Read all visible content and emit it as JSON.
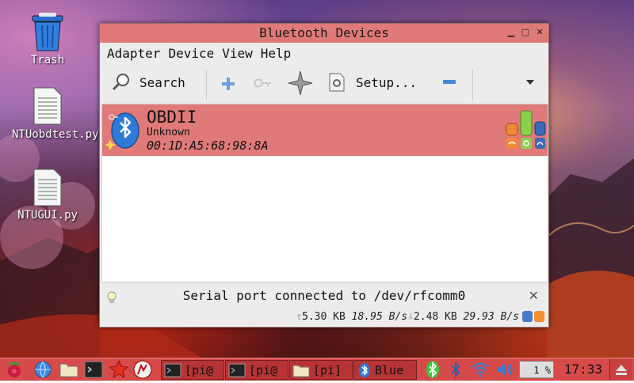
{
  "desktop": {
    "icons": [
      {
        "label": "Trash"
      },
      {
        "label": "NTUobdtest.py"
      },
      {
        "label": "NTUGUI.py"
      }
    ]
  },
  "window": {
    "title": "Bluetooth Devices",
    "menu": [
      "Adapter",
      "Device",
      "View",
      "Help"
    ],
    "toolbar": {
      "search_label": "Search",
      "setup_label": "Setup..."
    },
    "device": {
      "name": "OBDII",
      "type": "Unknown",
      "address": "00:1D:A5:68:98:8A"
    },
    "status_text": "Serial port connected to /dev/rfcomm0",
    "stats": {
      "up_amount": "5.30 KB",
      "up_rate": "18.95 B/s",
      "down_amount": "2.48 KB",
      "down_rate": "29.93 B/s"
    }
  },
  "taskbar": {
    "tasks": [
      {
        "label": "[pi@"
      },
      {
        "label": "[pi@"
      },
      {
        "label": "[pi]"
      },
      {
        "label": "Blue"
      }
    ],
    "cpu": "1 %",
    "clock": "17:33"
  },
  "colors": {
    "accent": "#e07a78",
    "taskbar": "#d64a4a",
    "bluetooth_blue": "#2f7ad6"
  }
}
